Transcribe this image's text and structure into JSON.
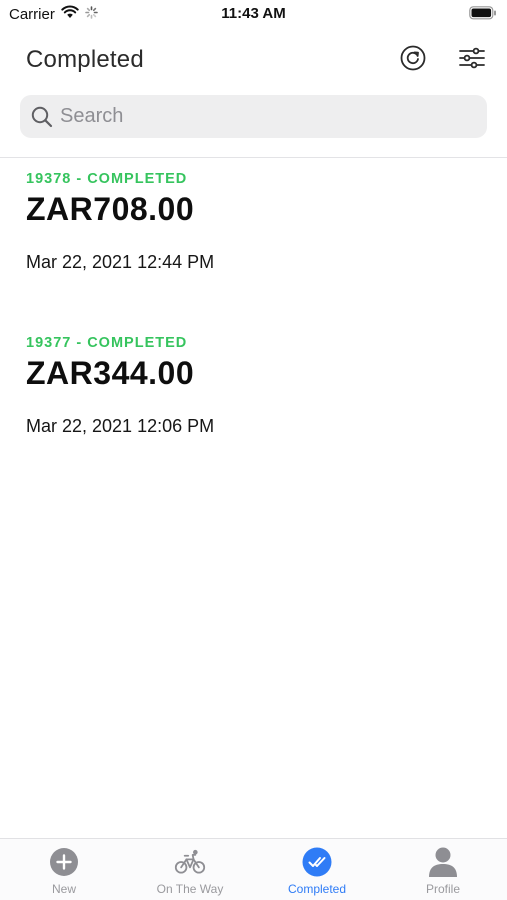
{
  "status_bar": {
    "carrier": "Carrier",
    "time": "11:43 AM",
    "icons": [
      "wifi-icon",
      "activity-spinner-icon",
      "battery-icon"
    ]
  },
  "header": {
    "title": "Completed",
    "actions": [
      "refresh-icon",
      "filter-sliders-icon"
    ]
  },
  "search": {
    "placeholder": "Search",
    "value": ""
  },
  "orders": [
    {
      "status": "19378 - COMPLETED",
      "amount": "ZAR708.00",
      "date": "Mar 22, 2021 12:44 PM"
    },
    {
      "status": "19377 - COMPLETED",
      "amount": "ZAR344.00",
      "date": "Mar 22, 2021 12:06 PM"
    }
  ],
  "tab_bar": {
    "tabs": [
      {
        "label": "New",
        "icon": "plus-circle-icon",
        "active": false
      },
      {
        "label": "On The Way",
        "icon": "bicycle-icon",
        "active": false
      },
      {
        "label": "Completed",
        "icon": "double-check-circle-icon",
        "active": true
      },
      {
        "label": "Profile",
        "icon": "person-icon",
        "active": false
      }
    ]
  },
  "colors": {
    "status_green": "#36c45e",
    "accent_blue": "#2f7cf6",
    "inactive_gray": "#9a9a9e"
  }
}
